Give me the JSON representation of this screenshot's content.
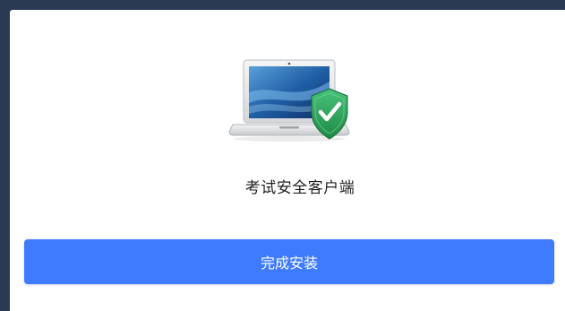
{
  "product": {
    "name": "考试安全客户端",
    "icon": "laptop-shield-icon"
  },
  "actions": {
    "finish_label": "完成安装"
  },
  "colors": {
    "backdrop": "#2a3a52",
    "dialog_bg": "#ffffff",
    "primary": "#3f7bff",
    "shield": "#2fa35a"
  }
}
